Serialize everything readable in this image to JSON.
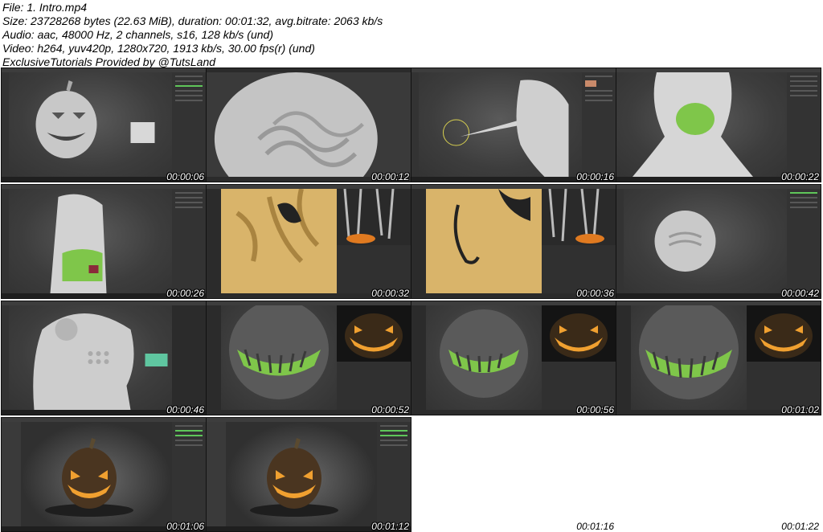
{
  "header": {
    "line1": "File: 1. Intro.mp4",
    "line2": "Size: 23728268 bytes (22.63 MiB), duration: 00:01:32, avg.bitrate: 2063 kb/s",
    "line3": "Audio: aac, 48000 Hz, 2 channels, s16, 128 kb/s (und)",
    "line4": "Video: h264, yuv420p, 1280x720, 1913 kb/s, 30.00 fps(r) (und)",
    "line5": "ExclusiveTutorials Provided by @TutsLand"
  },
  "thumbnails": [
    {
      "timestamp": "00:00:06"
    },
    {
      "timestamp": "00:00:12"
    },
    {
      "timestamp": "00:00:16"
    },
    {
      "timestamp": "00:00:22"
    },
    {
      "timestamp": "00:00:26"
    },
    {
      "timestamp": "00:00:32"
    },
    {
      "timestamp": "00:00:36"
    },
    {
      "timestamp": "00:00:42"
    },
    {
      "timestamp": "00:00:46"
    },
    {
      "timestamp": "00:00:52"
    },
    {
      "timestamp": "00:00:56"
    },
    {
      "timestamp": "00:01:02"
    },
    {
      "timestamp": "00:01:06"
    },
    {
      "timestamp": "00:01:12"
    },
    {
      "timestamp": "00:01:16"
    },
    {
      "timestamp": "00:01:22"
    }
  ],
  "colors": {
    "sculpt_gray": "#cfcfcf",
    "mask_green": "#7fc64a",
    "cloth_yellow": "#d9b46a",
    "glow_orange": "#f0a030"
  }
}
